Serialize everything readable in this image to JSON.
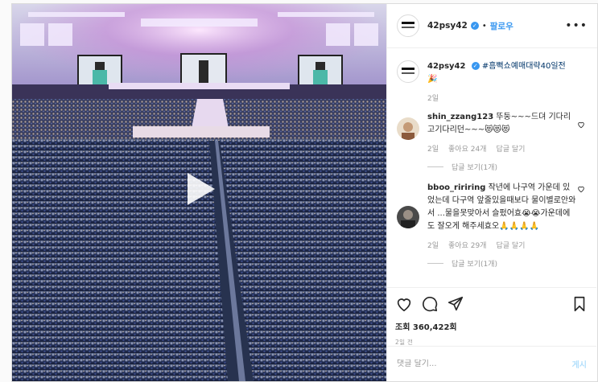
{
  "post": {
    "username": "42psy42",
    "follow_label": "팔로우",
    "more_label": "•••",
    "caption_username": "42psy42",
    "caption_text": "#흠뻑쇼예매대략40일전",
    "caption_emoji": "🎉",
    "caption_time": "2일"
  },
  "comments": [
    {
      "username": "shin_zzang123",
      "text": "뚜둥~~~드뎌 기다리고기다리던~~~😻😻😻",
      "time": "2일",
      "likes": "좋아요 24개",
      "reply_label": "답글 달기",
      "view_replies": "답글 보기(1개)"
    },
    {
      "username": "bboo_ririring",
      "text": "작년에 나구역 가운데 있었는데 다구역 앞줄있을때보다 물이별로안와서 ...물을못맞아서 슬펐어효😭😭가운데에도 잘오게 해주세효오🙏🙏🙏🙏",
      "time": "2일",
      "likes": "좋아요 29개",
      "reply_label": "답글 달기",
      "view_replies": "답글 보기(1개)"
    }
  ],
  "stats": {
    "views": "조회 360,422회",
    "time_ago": "2일 전"
  },
  "comment_box": {
    "placeholder": "댓글 달기...",
    "post_label": "게시"
  },
  "colors": {
    "accent": "#3897f0",
    "hashtag": "#003569",
    "muted": "#999999"
  }
}
